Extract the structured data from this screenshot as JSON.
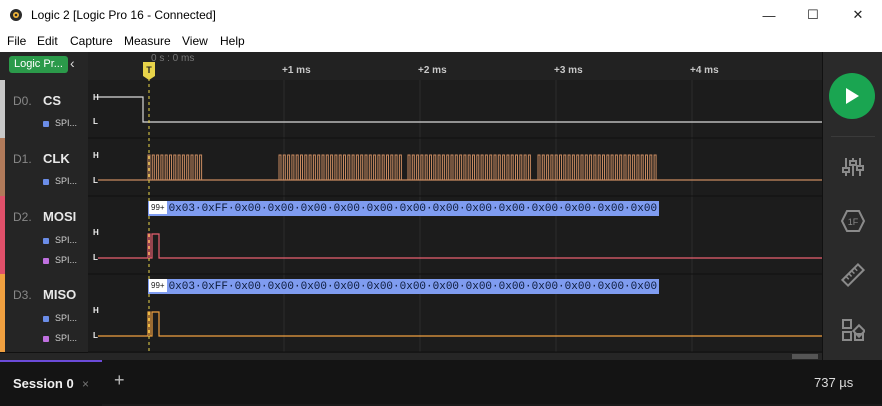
{
  "window": {
    "title": "Logic 2 [Logic Pro 16 - Connected]",
    "min": "—",
    "max": "☐",
    "close": "✕"
  },
  "menu": [
    "File",
    "Edit",
    "Capture",
    "Measure",
    "View",
    "Help"
  ],
  "device": {
    "badge": "Logic Pr...",
    "collapse": "‹"
  },
  "ruler": {
    "origin": "0 s : 0 ms",
    "ticks": [
      "+1 ms",
      "+2 ms",
      "+3 ms",
      "+4 ms"
    ],
    "trigger_label": "T"
  },
  "channels": [
    {
      "id": "D0.",
      "name": "CS",
      "color": "#c8c8c8",
      "analyzers": [
        {
          "label": "SPI...",
          "color": "#6b8de8"
        }
      ]
    },
    {
      "id": "D1.",
      "name": "CLK",
      "color": "#b07a5a",
      "analyzers": [
        {
          "label": "SPI...",
          "color": "#6b8de8"
        }
      ]
    },
    {
      "id": "D2.",
      "name": "MOSI",
      "color": "#e0506a",
      "analyzers": [
        {
          "label": "SPI...",
          "color": "#6b8de8"
        },
        {
          "label": "SPI...",
          "color": "#c070e0"
        }
      ]
    },
    {
      "id": "D3.",
      "name": "MISO",
      "color": "#f0a040",
      "analyzers": [
        {
          "label": "SPI...",
          "color": "#6b8de8"
        },
        {
          "label": "SPI...",
          "color": "#c070e0"
        }
      ]
    }
  ],
  "levels": {
    "high": "H",
    "low": "L"
  },
  "decoded": {
    "mosi": {
      "count": "99+",
      "text": "0x03·0xFF·0x00·0x00·0x00·0x00·0x00·0x00·0x00·0x00·0x00·0x00·0x00·0x00·0x00·0x00·0x00·0x0"
    },
    "miso": {
      "count": "99+",
      "text": "0x03·0xFF·0x00·0x00·0x00·0x00·0x00·0x00·0x00·0x00·0x00·0x00·0x00·0x00·0x00·0x00·0x00·0x0"
    }
  },
  "sidebar_tools": [
    "play-icon",
    "sliders-icon",
    "timing-marker-icon",
    "ruler-icon",
    "extensions-icon"
  ],
  "session": {
    "tab": "Session 0",
    "close": "×",
    "add": "+",
    "duration": "737 µs"
  },
  "colors": {
    "accent": "#1aa551",
    "session_tab": "#6b4bd8",
    "trigger": "#e8d44a",
    "decode": "#7f9cf0"
  }
}
